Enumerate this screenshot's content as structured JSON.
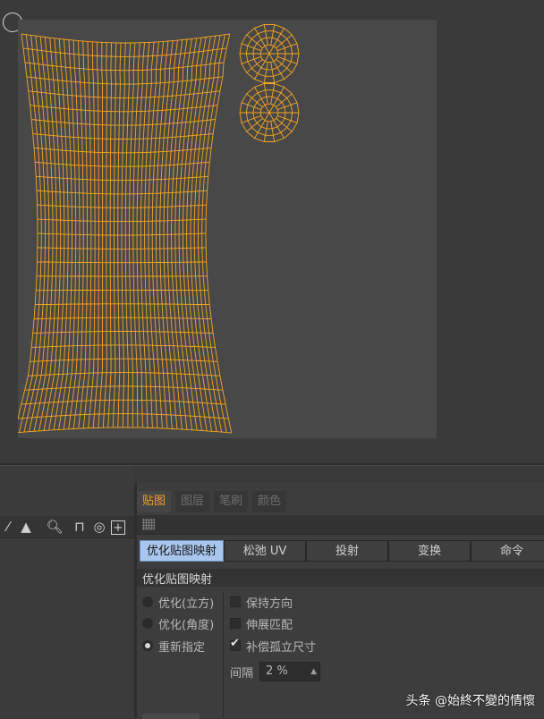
{
  "colors": {
    "uv_wire": "#f5a623",
    "accent_tab": "#f0a020",
    "active_subtab": "#a9c7ee"
  },
  "tabs": [
    {
      "label": "贴图",
      "active": true
    },
    {
      "label": "图层",
      "active": false
    },
    {
      "label": "笔刷",
      "active": false
    },
    {
      "label": "颜色",
      "active": false
    }
  ],
  "subtabs": [
    {
      "label": "优化贴图映射",
      "active": true
    },
    {
      "label": "松弛 UV",
      "active": false
    },
    {
      "label": "投射",
      "active": false
    },
    {
      "label": "变换",
      "active": false
    },
    {
      "label": "命令",
      "active": false
    }
  ],
  "section": {
    "title": "优化贴图映射"
  },
  "radios": [
    {
      "label": "优化(立方)",
      "selected": false
    },
    {
      "label": "优化(角度)",
      "selected": false
    },
    {
      "label": "重新指定",
      "selected": true
    }
  ],
  "checks": [
    {
      "label": "保持方向",
      "checked": false
    },
    {
      "label": "伸展匹配",
      "checked": false
    },
    {
      "label": "补偿孤立尺寸",
      "checked": true
    }
  ],
  "spacing": {
    "label": "间隔",
    "value": "2 %"
  },
  "left_toolbar_icons": [
    "arrow-icon",
    "magnifier-icon",
    "lock-icon",
    "target-icon",
    "add-frame-icon"
  ],
  "watermark": "头条 @始終不變的情懷"
}
